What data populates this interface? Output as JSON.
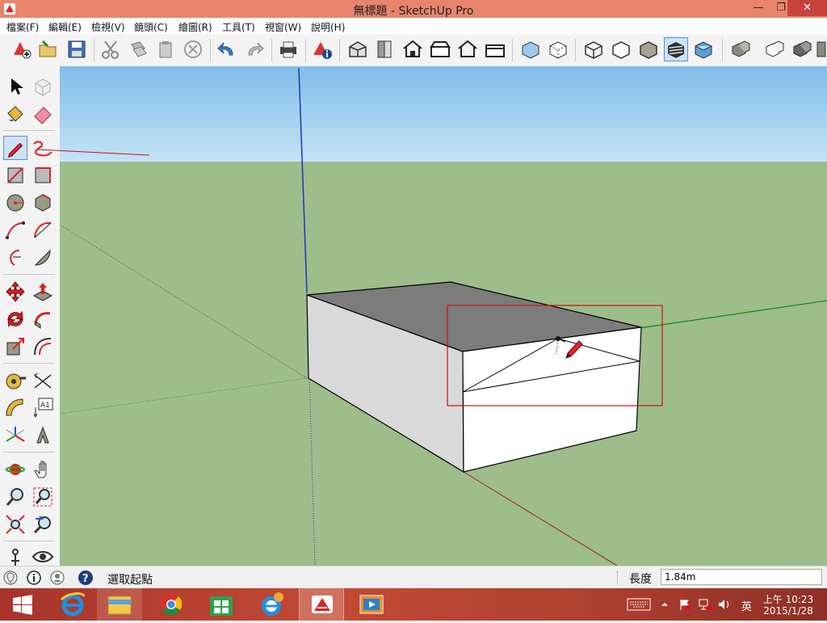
{
  "window": {
    "title": "無標題 - SketchUp Pro",
    "minimize": "—",
    "maximize": "❐",
    "close": "✕"
  },
  "menu": [
    "檔案(F)",
    "編輯(E)",
    "檢視(V)",
    "鏡頭(C)",
    "繪圖(R)",
    "工具(T)",
    "視窗(W)",
    "說明(H)"
  ],
  "status": {
    "prompt": "選取起點",
    "measure_label": "長度",
    "measure_value": "1.84m"
  },
  "taskbar": {
    "ime": "英",
    "time": "上午 10:23",
    "date": "2015/1/28"
  },
  "colors": {
    "titlebar": "#e8846c",
    "sky": "#a9d3f1",
    "ground": "#9dbd8b",
    "taskbar": "#b0402f",
    "annotation": "#cc1111"
  }
}
